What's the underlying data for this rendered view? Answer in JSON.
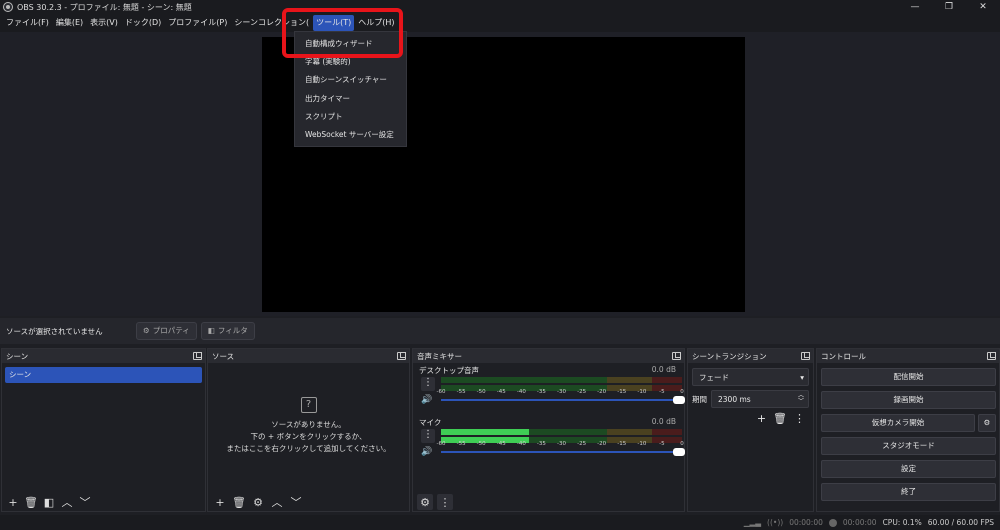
{
  "window": {
    "title": "OBS 30.2.3 - プロファイル: 無題 - シーン: 無題",
    "minimize": "—",
    "maximize": "❐",
    "close": "✕"
  },
  "menu": [
    "ファイル(F)",
    "編集(E)",
    "表示(V)",
    "ドック(D)",
    "プロファイル(P)",
    "シーンコレクション(",
    "ツール(T)",
    "ヘルプ(H)"
  ],
  "tools_menu": [
    "自動構成ウィザード",
    "字幕 (実験的)",
    "自動シーンスイッチャー",
    "出力タイマー",
    "スクリプト",
    "WebSocket サーバー設定"
  ],
  "props": {
    "no_source": "ソースが選択されていません",
    "properties": "プロパティ",
    "filters": "フィルタ"
  },
  "scenes": {
    "title": "シーン",
    "items": [
      "シーン"
    ]
  },
  "sources": {
    "title": "ソース",
    "q": "?",
    "empty1": "ソースがありません。",
    "empty2": "下の + ボタンをクリックするか、",
    "empty3": "またはここを右クリックして追加してください。"
  },
  "mixer": {
    "title": "音声ミキサー",
    "channels": [
      {
        "name": "デスクトップ音声",
        "db": "0.0 dB",
        "level_db": -60
      },
      {
        "name": "マイク",
        "db": "0.0 dB",
        "level_db": -38
      }
    ],
    "ticks": [
      "-60",
      "-55",
      "-50",
      "-45",
      "-40",
      "-35",
      "-30",
      "-25",
      "-20",
      "-15",
      "-10",
      "-5",
      "0"
    ]
  },
  "transitions": {
    "title": "シーントランジション",
    "type": "フェード",
    "duration_label": "期間",
    "duration": "2300 ms"
  },
  "controls": {
    "title": "コントロール",
    "buttons": [
      "配信開始",
      "録画開始",
      "仮想カメラ開始",
      "スタジオモード",
      "設定",
      "終了"
    ]
  },
  "status": {
    "rec_time": "00:00:00",
    "stream_time": "00:00:00",
    "cpu": "CPU: 0.1%",
    "fps": "60.00 / 60.00 FPS"
  },
  "colors": {
    "accent": "#2c54b8",
    "highlight": "#e8141a"
  }
}
